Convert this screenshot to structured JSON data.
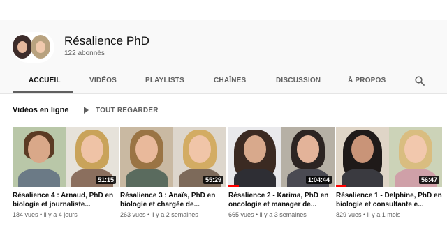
{
  "channel": {
    "name": "Résalience PhD",
    "subscribers": "122 abonnés"
  },
  "tabs": [
    {
      "label": "ACCUEIL",
      "active": true
    },
    {
      "label": "VIDÉOS"
    },
    {
      "label": "PLAYLISTS"
    },
    {
      "label": "CHAÎNES"
    },
    {
      "label": "DISCUSSION"
    },
    {
      "label": "À PROPOS"
    }
  ],
  "icons": {
    "search": "search-icon",
    "play_all": "play-icon"
  },
  "section": {
    "title": "Vidéos en ligne",
    "play_all_label": "TOUT REGARDER"
  },
  "videos": [
    {
      "title": "Résalience 4 : Arnaud, PhD en biologie et journaliste...",
      "duration": "51:15",
      "views": "184 vues",
      "age": "il y a 4 jours",
      "watched": 0
    },
    {
      "title": "Résalience 3 : Anaïs, PhD en biologie et chargée de...",
      "duration": "55:29",
      "views": "263 vues",
      "age": "il y a 2 semaines",
      "watched": 0
    },
    {
      "title": "Résalience 2 - Karima, PhD en oncologie et manager de...",
      "duration": "1:04:44",
      "views": "665 vues",
      "age": "il y a 3 semaines",
      "watched": 0.1
    },
    {
      "title": "Résalience 1 - Delphine, PhD en biologie et consultante e...",
      "duration": "56:47",
      "views": "829 vues",
      "age": "il y a 1 mois",
      "watched": 0.1
    }
  ],
  "colors": {
    "accent": "#ff0000",
    "text_secondary": "#606060"
  }
}
